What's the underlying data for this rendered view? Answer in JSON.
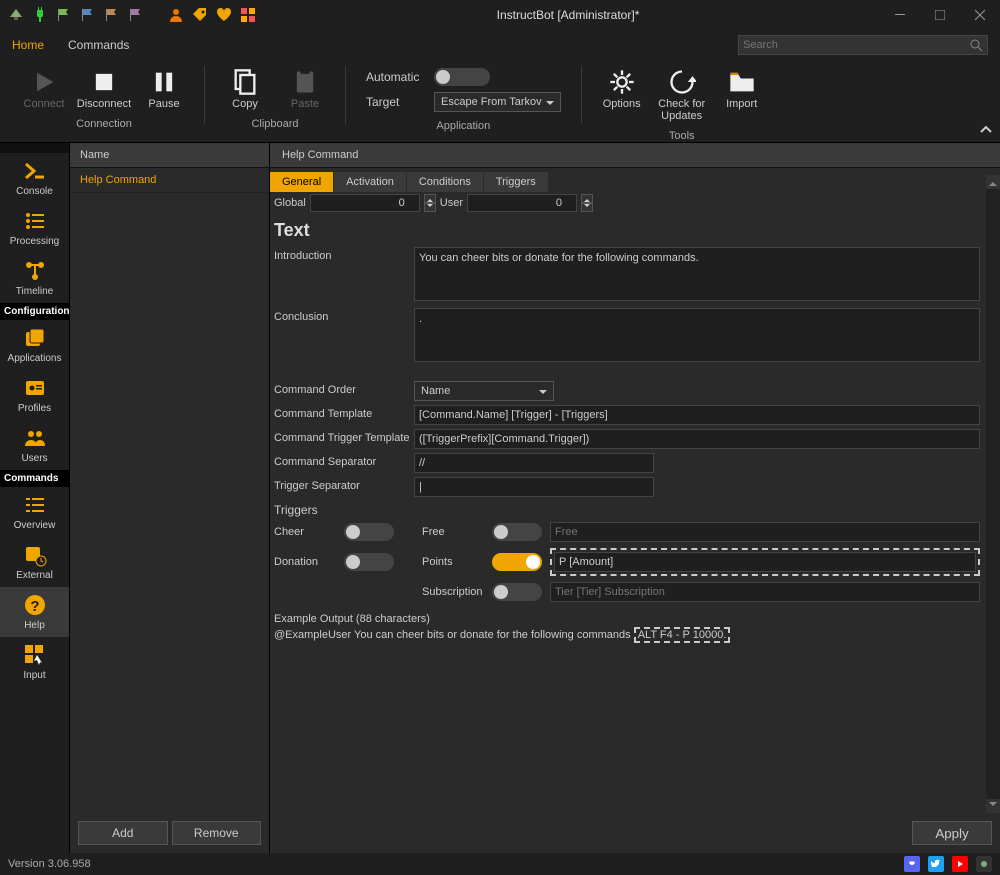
{
  "title": "InstructBot [Administrator]*",
  "menu": {
    "home": "Home",
    "commands": "Commands"
  },
  "search_placeholder": "Search",
  "ribbon": {
    "connect": "Connect",
    "disconnect": "Disconnect",
    "pause": "Pause",
    "copy": "Copy",
    "paste": "Paste",
    "automatic": "Automatic",
    "target": "Target",
    "target_value": "Escape From Tarkov",
    "options": "Options",
    "check": "Check for Updates",
    "import": "Import",
    "group_connection": "Connection",
    "group_clipboard": "Clipboard",
    "group_application": "Application",
    "group_tools": "Tools"
  },
  "nav": {
    "console": "Console",
    "processing": "Processing",
    "timeline": "Timeline",
    "configuration": "Configuration",
    "applications": "Applications",
    "profiles": "Profiles",
    "users": "Users",
    "commands": "Commands",
    "overview": "Overview",
    "external": "External",
    "help": "Help",
    "input": "Input"
  },
  "list": {
    "header": "Name",
    "item0": "Help Command",
    "add": "Add",
    "remove": "Remove"
  },
  "editor": {
    "title": "Help Command",
    "tabs": {
      "general": "General",
      "activation": "Activation",
      "conditions": "Conditions",
      "triggers": "Triggers"
    },
    "global_lbl": "Global",
    "global_val": "0",
    "user_lbl": "User",
    "user_val": "0",
    "section_text": "Text",
    "intro_lbl": "Introduction",
    "intro_val": "You can cheer bits or donate for the following commands.",
    "concl_lbl": "Conclusion",
    "concl_val": ".",
    "cmd_order_lbl": "Command Order",
    "cmd_order_val": "Name",
    "cmd_tpl_lbl": "Command Template",
    "cmd_tpl_val": "[Command.Name] [Trigger] - [Triggers]",
    "cmd_trig_tpl_lbl": "Command Trigger Template",
    "cmd_trig_tpl_val": "([TriggerPrefix][Command.Trigger])",
    "cmd_sep_lbl": "Command Separator",
    "cmd_sep_val": "//",
    "trig_sep_lbl": "Trigger Separator",
    "trig_sep_val": "|",
    "triggers_h": "Triggers",
    "cheer_lbl": "Cheer",
    "free_lbl": "Free",
    "free_ph": "Free",
    "donation_lbl": "Donation",
    "points_lbl": "Points",
    "points_val": "P [Amount]",
    "sub_lbl": "Subscription",
    "sub_ph": "Tier [Tier] Subscription",
    "example_h": "Example Output (88 characters)",
    "example_line_a": "@ExampleUser You can cheer bits or donate for the following commands ",
    "example_line_b": " ALT F4  - P 10000.",
    "apply": "Apply"
  },
  "status": {
    "version": "Version 3.06.958"
  }
}
